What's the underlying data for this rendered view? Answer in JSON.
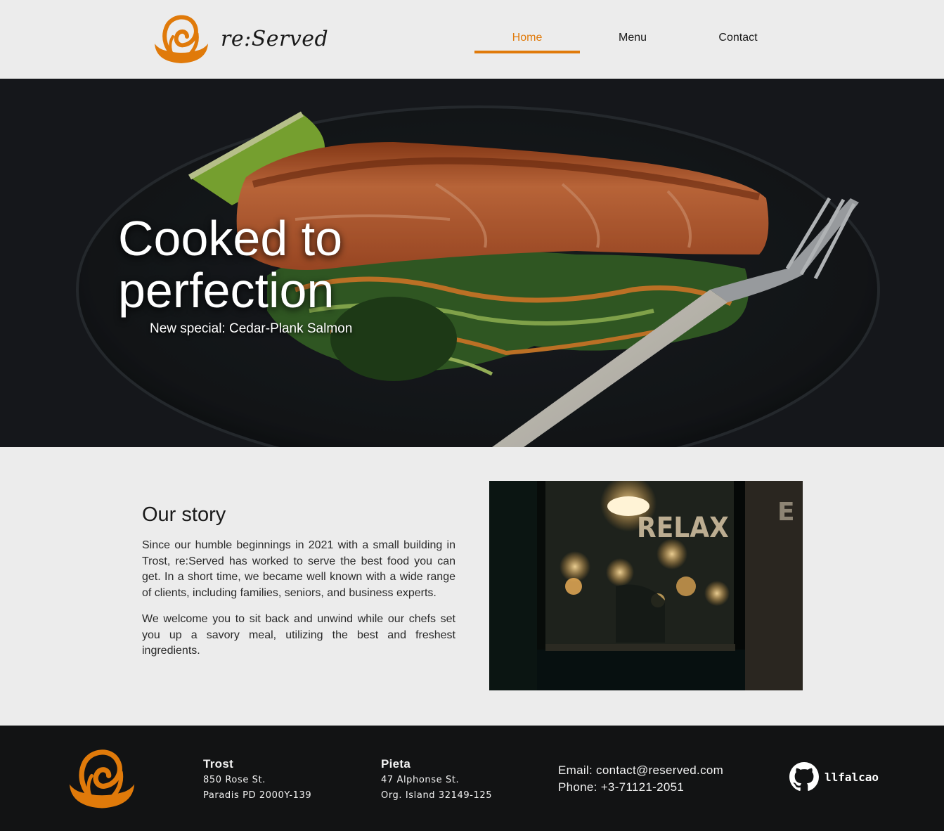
{
  "brand": {
    "name": "re:Served",
    "logo_icon": "chef-bowl-logo-icon",
    "accent_color": "#e07a0a"
  },
  "nav": {
    "items": [
      {
        "label": "Home",
        "active": true
      },
      {
        "label": "Menu",
        "active": false
      },
      {
        "label": "Contact",
        "active": false
      }
    ]
  },
  "hero": {
    "title": "Cooked to perfection",
    "subtitle": "New special: Cedar-Plank Salmon"
  },
  "story": {
    "heading": "Our story",
    "paragraphs": [
      "Since our humble beginnings in 2021 with a small building in Trost, re:Served has worked to serve the best food you can get. In a short time, we became well known with a wide range of clients, including families, seniors, and business experts.",
      "We welcome you to sit back and unwind while our chefs set you up a savory meal, utilizing the best and freshest ingredients."
    ],
    "photo_sign": "RELAX",
    "photo_sign_edge": "E"
  },
  "footer": {
    "locations": [
      {
        "name": "Trost",
        "line1": "850 Rose St.",
        "line2": "Paradis PD 2000Y-139"
      },
      {
        "name": "Pieta",
        "line1": "47 Alphonse St.",
        "line2": "Org. Island 32149-125"
      }
    ],
    "email": "Email: contact@reserved.com",
    "phone": "Phone: +3-71121-2051",
    "github_icon": "github-icon",
    "github_user": "llfalcao"
  }
}
